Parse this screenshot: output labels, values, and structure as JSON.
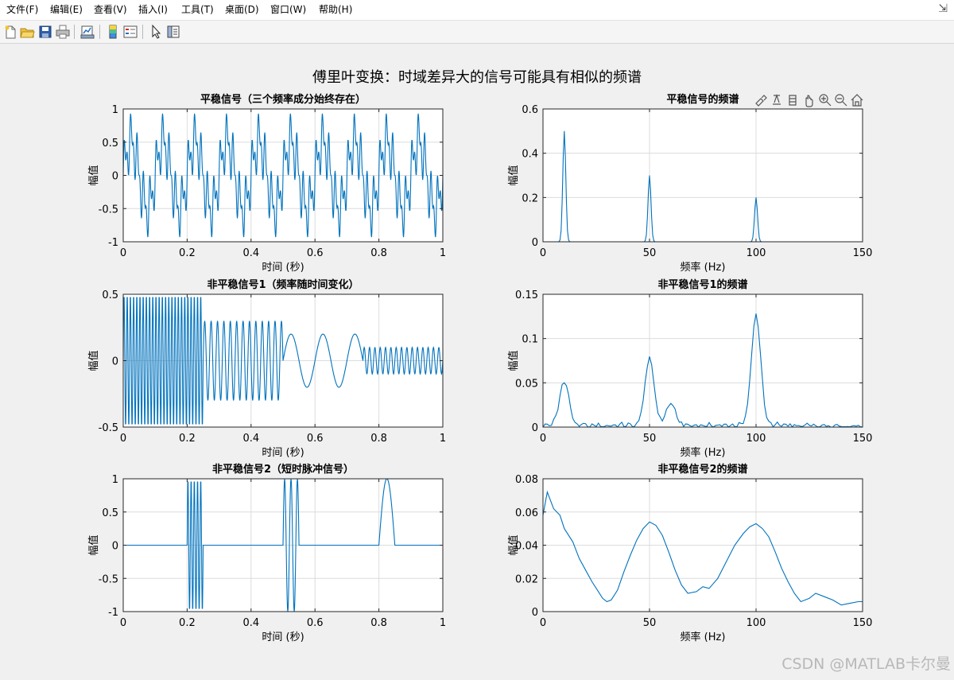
{
  "menu": {
    "items": [
      "文件(F)",
      "编辑(E)",
      "查看(V)",
      "插入(I)",
      "工具(T)",
      "桌面(D)",
      "窗口(W)",
      "帮助(H)"
    ]
  },
  "toolbar": {
    "buttons": [
      "new-figure",
      "open-file",
      "save",
      "print",
      "link-plot",
      "insert-colorbar",
      "insert-legend",
      "edit-plot",
      "property-inspector"
    ]
  },
  "figure": {
    "suptitle": "傅里叶变换：时域差异大的信号可能具有相似的频谱"
  },
  "axes_toolbar": [
    "brush",
    "data-tips",
    "rotate",
    "pan",
    "zoom-in",
    "zoom-out",
    "restore-view"
  ],
  "watermark": "CSDN @MATLAB卡尔曼",
  "colors": {
    "line": "#0072bd",
    "grid": "#dcdcdc",
    "axes_bg": "#ffffff",
    "figure_bg": "#f0f0f0"
  },
  "chart_data": [
    {
      "type": "line",
      "title": "平稳信号（三个频率成分始终存在）",
      "xlabel": "时间 (秒)",
      "ylabel": "幅值",
      "xlim": [
        0,
        1
      ],
      "ylim": [
        -1,
        1
      ],
      "xticks": [
        0,
        0.2,
        0.4,
        0.6,
        0.8,
        1
      ],
      "xticklabels": [
        "0",
        "0.2",
        "0.4",
        "0.6",
        "0.8",
        "1"
      ],
      "yticks": [
        -1,
        -0.5,
        0,
        0.5,
        1
      ],
      "yticklabels": [
        "-1",
        "-0.5",
        "0",
        "0.5",
        "1"
      ],
      "grid": true,
      "signal": {
        "kind": "sum_sines",
        "fs": 1000,
        "components": [
          {
            "freq": 10,
            "amp": 0.5
          },
          {
            "freq": 50,
            "amp": 0.3
          },
          {
            "freq": 100,
            "amp": 0.2
          }
        ]
      }
    },
    {
      "type": "line",
      "title": "平稳信号的频谱",
      "xlabel": "频率 (Hz)",
      "ylabel": "幅值",
      "xlim": [
        0,
        150
      ],
      "ylim": [
        0,
        0.6
      ],
      "xticks": [
        0,
        50,
        100,
        150
      ],
      "xticklabels": [
        "0",
        "50",
        "100",
        "150"
      ],
      "yticks": [
        0,
        0.2,
        0.4,
        0.6
      ],
      "yticklabels": [
        "0",
        "0.2",
        "0.4",
        "0.6"
      ],
      "grid": true,
      "peaks": [
        {
          "freq": 10,
          "amp": 0.5
        },
        {
          "freq": 50,
          "amp": 0.3
        },
        {
          "freq": 100,
          "amp": 0.2
        }
      ]
    },
    {
      "type": "line",
      "title": "非平稳信号1（频率随时间变化）",
      "xlabel": "时间 (秒)",
      "ylabel": "幅值",
      "xlim": [
        0,
        1
      ],
      "ylim": [
        -0.5,
        0.5
      ],
      "xticks": [
        0,
        0.2,
        0.4,
        0.6,
        0.8,
        1
      ],
      "xticklabels": [
        "0",
        "0.2",
        "0.4",
        "0.6",
        "0.8",
        "1"
      ],
      "yticks": [
        -0.5,
        0,
        0.5
      ],
      "yticklabels": [
        "-0.5",
        "0",
        "0.5"
      ],
      "grid": true,
      "signal": {
        "kind": "segments",
        "fs": 1000,
        "segments": [
          {
            "start": 0,
            "end": 0.25,
            "freq": 100,
            "amp": 0.5
          },
          {
            "start": 0.25,
            "end": 0.5,
            "freq": 50,
            "amp": 0.3
          },
          {
            "start": 0.5,
            "end": 0.75,
            "freq": 10,
            "amp": 0.2
          },
          {
            "start": 0.75,
            "end": 1.0,
            "freq": 60,
            "amp": 0.1
          }
        ]
      }
    },
    {
      "type": "line",
      "title": "非平稳信号1的频谱",
      "xlabel": "频率 (Hz)",
      "ylabel": "幅值",
      "xlim": [
        0,
        150
      ],
      "ylim": [
        0,
        0.15
      ],
      "xticks": [
        0,
        50,
        100,
        150
      ],
      "xticklabels": [
        "0",
        "50",
        "100",
        "150"
      ],
      "yticks": [
        0,
        0.05,
        0.1,
        0.15
      ],
      "yticklabels": [
        "0",
        "0.05",
        "0.1",
        "0.15"
      ],
      "grid": true,
      "peaks": [
        {
          "freq": 10,
          "amp": 0.05
        },
        {
          "freq": 50,
          "amp": 0.075
        },
        {
          "freq": 60,
          "amp": 0.025
        },
        {
          "freq": 100,
          "amp": 0.125
        }
      ]
    },
    {
      "type": "line",
      "title": "非平稳信号2（短时脉冲信号）",
      "xlabel": "时间 (秒)",
      "ylabel": "幅值",
      "xlim": [
        0,
        1
      ],
      "ylim": [
        -1,
        1
      ],
      "xticks": [
        0,
        0.2,
        0.4,
        0.6,
        0.8,
        1
      ],
      "xticklabels": [
        "0",
        "0.2",
        "0.4",
        "0.6",
        "0.8",
        "1"
      ],
      "yticks": [
        -1,
        -0.5,
        0,
        0.5,
        1
      ],
      "yticklabels": [
        "-1",
        "-0.5",
        "0",
        "0.5",
        "1"
      ],
      "grid": true,
      "signal": {
        "kind": "segments",
        "fs": 1000,
        "segments": [
          {
            "start": 0.2,
            "end": 0.25,
            "freq": 100,
            "amp": 1
          },
          {
            "start": 0.5,
            "end": 0.55,
            "freq": 50,
            "amp": 1
          },
          {
            "start": 0.8,
            "end": 0.85,
            "freq": 10,
            "amp": 1
          }
        ]
      }
    },
    {
      "type": "line",
      "title": "非平稳信号2的频谱",
      "xlabel": "频率 (Hz)",
      "ylabel": "幅值",
      "xlim": [
        0,
        150
      ],
      "ylim": [
        0,
        0.08
      ],
      "xticks": [
        0,
        50,
        100,
        150
      ],
      "xticklabels": [
        "0",
        "50",
        "100",
        "150"
      ],
      "yticks": [
        0,
        0.02,
        0.04,
        0.06,
        0.08
      ],
      "yticklabels": [
        "0",
        "0.02",
        "0.04",
        "0.06",
        "0.08"
      ],
      "grid": true,
      "approx_points": [
        [
          0,
          0.058
        ],
        [
          2,
          0.072
        ],
        [
          5,
          0.062
        ],
        [
          8,
          0.058
        ],
        [
          10,
          0.05
        ],
        [
          14,
          0.042
        ],
        [
          17,
          0.032
        ],
        [
          20,
          0.025
        ],
        [
          23,
          0.018
        ],
        [
          26,
          0.012
        ],
        [
          28,
          0.008
        ],
        [
          30,
          0.006
        ],
        [
          32,
          0.007
        ],
        [
          35,
          0.013
        ],
        [
          38,
          0.024
        ],
        [
          41,
          0.034
        ],
        [
          44,
          0.043
        ],
        [
          47,
          0.05
        ],
        [
          50,
          0.054
        ],
        [
          53,
          0.052
        ],
        [
          56,
          0.046
        ],
        [
          59,
          0.036
        ],
        [
          62,
          0.025
        ],
        [
          65,
          0.016
        ],
        [
          68,
          0.011
        ],
        [
          72,
          0.012
        ],
        [
          75,
          0.015
        ],
        [
          78,
          0.014
        ],
        [
          82,
          0.02
        ],
        [
          86,
          0.03
        ],
        [
          90,
          0.04
        ],
        [
          94,
          0.047
        ],
        [
          97,
          0.051
        ],
        [
          100,
          0.053
        ],
        [
          103,
          0.05
        ],
        [
          106,
          0.045
        ],
        [
          109,
          0.036
        ],
        [
          112,
          0.026
        ],
        [
          115,
          0.018
        ],
        [
          118,
          0.011
        ],
        [
          121,
          0.006
        ],
        [
          125,
          0.008
        ],
        [
          128,
          0.011
        ],
        [
          132,
          0.009
        ],
        [
          136,
          0.007
        ],
        [
          140,
          0.004
        ],
        [
          144,
          0.005
        ],
        [
          148,
          0.006
        ],
        [
          150,
          0.006
        ]
      ]
    }
  ]
}
